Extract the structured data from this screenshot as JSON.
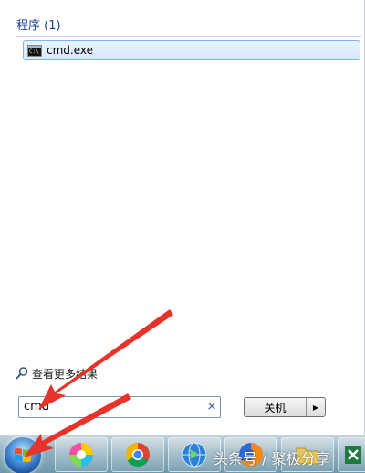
{
  "results": {
    "group_header": "程序 (1)",
    "items": [
      {
        "label": "cmd.exe",
        "icon": "cmd-icon",
        "icon_text": "C:\\"
      }
    ]
  },
  "see_more": {
    "label": "查看更多结果",
    "icon": "magnifier-icon"
  },
  "search": {
    "value": "cmd",
    "clear_glyph": "×"
  },
  "shutdown": {
    "label": "关机",
    "arrow_glyph": "▶"
  },
  "taskbar": {
    "items": [
      {
        "name": "start-button",
        "icon": "windows-logo-icon"
      },
      {
        "name": "pinwheel-app",
        "icon": "pinwheel-icon"
      },
      {
        "name": "chrome",
        "icon": "chrome-icon"
      },
      {
        "name": "network-globe",
        "icon": "globe-icon"
      },
      {
        "name": "firefox",
        "icon": "firefox-icon"
      },
      {
        "name": "folder-app",
        "icon": "folder-icon"
      },
      {
        "name": "excel",
        "icon": "excel-icon"
      }
    ]
  },
  "watermark": "头条号 / 聚极分享",
  "colors": {
    "accent_blue": "#1e3f91",
    "highlight_border": "#7eb4ea",
    "annotation_red": "#e8322a"
  }
}
